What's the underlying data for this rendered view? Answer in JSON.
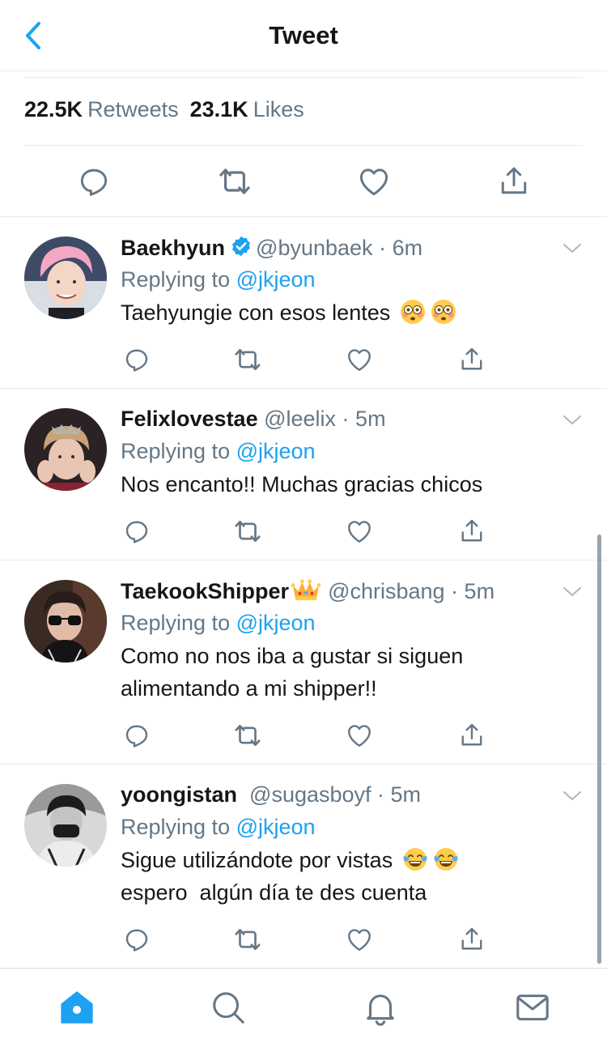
{
  "header": {
    "title": "Tweet",
    "back_icon": "chevron-left-icon"
  },
  "stats": {
    "retweets_count": "22.5K",
    "retweets_label": "Retweets",
    "likes_count": "23.1K",
    "likes_label": "Likes"
  },
  "colors": {
    "accent": "#1da1f2",
    "text": "#14171a",
    "muted": "#657786",
    "divider": "#e6ecf0"
  },
  "replies": [
    {
      "name": "Baekhyun",
      "verified": true,
      "handle": "@byunbaek",
      "time": "6m",
      "replying_prefix": "Replying to",
      "replying_to": "@jkjeon",
      "text": "Taehyungie con esos lentes",
      "emojis": [
        "flushed-face",
        "flushed-face"
      ]
    },
    {
      "name": "Felixlovestae",
      "verified": false,
      "handle": "@leelix",
      "time": "5m",
      "replying_prefix": "Replying to",
      "replying_to": "@jkjeon",
      "text": "Nos encanto!! Muchas gracias chicos"
    },
    {
      "name": "TaekookShipper",
      "name_emoji": "crown",
      "verified": false,
      "handle": "@chrisbang",
      "time": "5m",
      "replying_prefix": "Replying to",
      "replying_to": "@jkjeon",
      "text_line1": "Como no nos iba a gustar si siguen",
      "text_line2": "alimentando a mi shipper!!"
    },
    {
      "name": "yoongistan",
      "verified": false,
      "handle": "@sugasboyf",
      "time": "5m",
      "replying_prefix": "Replying to",
      "replying_to": "@jkjeon",
      "text_line1": "Sigue utilizándote por vistas",
      "text_line2": "espero  algún día te des cuenta",
      "emojis": [
        "tears-of-joy",
        "tears-of-joy"
      ]
    }
  ],
  "tabbar": {
    "tabs": [
      {
        "icon": "home-icon",
        "active": true
      },
      {
        "icon": "search-icon",
        "active": false
      },
      {
        "icon": "bell-icon",
        "active": false
      },
      {
        "icon": "mail-icon",
        "active": false
      }
    ]
  }
}
